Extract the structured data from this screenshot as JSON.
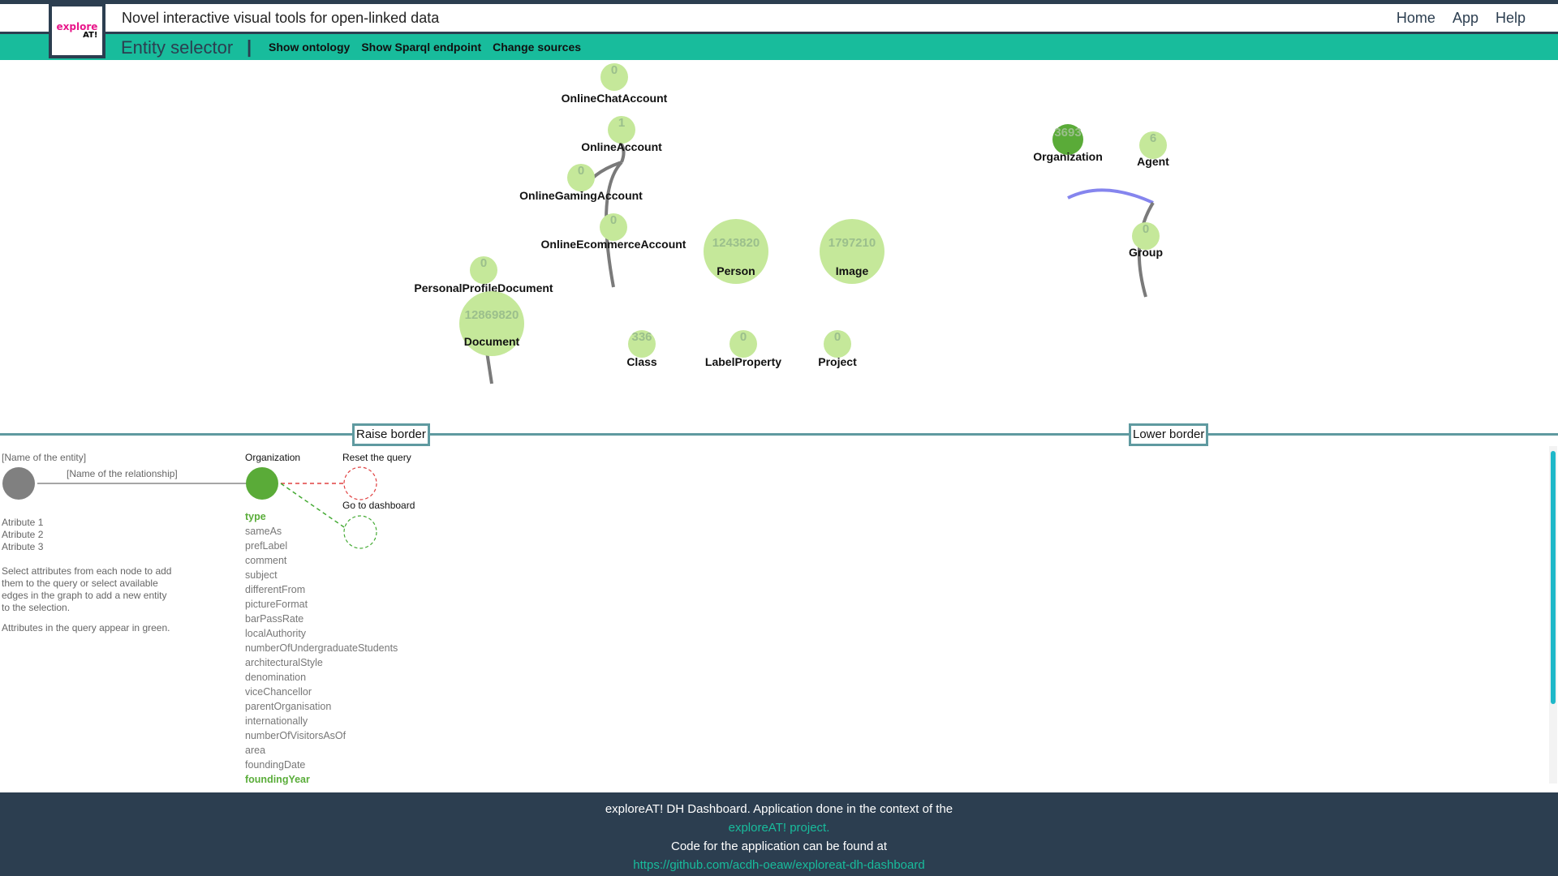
{
  "header": {
    "title": "Novel interactive visual tools for open-linked data",
    "nav": [
      "Home",
      "App",
      "Help"
    ],
    "logo_text_top": "explore",
    "logo_text_bottom": "AT!"
  },
  "subbar": {
    "page_name": "Entity selector",
    "separator": "|",
    "links": [
      "Show ontology",
      "Show Sparql endpoint",
      "Change sources"
    ]
  },
  "graph": {
    "nodes": [
      {
        "id": "OnlineChatAccount",
        "label": "OnlineChatAccount",
        "count": "0"
      },
      {
        "id": "OnlineAccount",
        "label": "OnlineAccount",
        "count": "1"
      },
      {
        "id": "OnlineGamingAccount",
        "label": "OnlineGamingAccount",
        "count": "0"
      },
      {
        "id": "OnlineEcommerceAccount",
        "label": "OnlineEcommerceAccount",
        "count": "0"
      },
      {
        "id": "PersonalProfileDocument",
        "label": "PersonalProfileDocument",
        "count": "0"
      },
      {
        "id": "Document",
        "label": "Document",
        "count": "12869820"
      },
      {
        "id": "Person",
        "label": "Person",
        "count": "1243820"
      },
      {
        "id": "Image",
        "label": "Image",
        "count": "1797210"
      },
      {
        "id": "Class",
        "label": "Class",
        "count": "336"
      },
      {
        "id": "LabelProperty",
        "label": "LabelProperty",
        "count": "0"
      },
      {
        "id": "Project",
        "label": "Project",
        "count": "0"
      },
      {
        "id": "Organization",
        "label": "Organization",
        "count": "3693",
        "selected": true
      },
      {
        "id": "Agent",
        "label": "Agent",
        "count": "6"
      },
      {
        "id": "Group",
        "label": "Group",
        "count": "0"
      }
    ],
    "colors": {
      "node": "#c5e89a",
      "selected_node": "#5aab38",
      "edge": "#7a7a7a",
      "query_edge": "#8585ee"
    }
  },
  "borders": {
    "raise": "Raise border",
    "lower": "Lower border"
  },
  "legend": {
    "entity_name": "[Name of the entity]",
    "relationship_name": "[Name of the relationship]",
    "attributes": [
      "Atribute 1",
      "Atribute 2",
      "Atribute 3"
    ],
    "help_text_lines": [
      "Select attributes from each node to add",
      "them to the query or select available",
      "edges in the graph to add a new entity",
      "to the selection."
    ],
    "help_text_2": "Attributes in the query appear in green."
  },
  "query": {
    "entity": "Organization",
    "reset_label": "Reset the query",
    "dashboard_label": "Go to dashboard",
    "attributes": [
      {
        "name": "type",
        "selected": true
      },
      {
        "name": "sameAs",
        "selected": false
      },
      {
        "name": "prefLabel",
        "selected": false
      },
      {
        "name": "comment",
        "selected": false
      },
      {
        "name": "subject",
        "selected": false
      },
      {
        "name": "differentFrom",
        "selected": false
      },
      {
        "name": "pictureFormat",
        "selected": false
      },
      {
        "name": "barPassRate",
        "selected": false
      },
      {
        "name": "localAuthority",
        "selected": false
      },
      {
        "name": "numberOfUndergraduateStudents",
        "selected": false
      },
      {
        "name": "architecturalStyle",
        "selected": false
      },
      {
        "name": "denomination",
        "selected": false
      },
      {
        "name": "viceChancellor",
        "selected": false
      },
      {
        "name": "parentOrganisation",
        "selected": false
      },
      {
        "name": "internationally",
        "selected": false
      },
      {
        "name": "numberOfVisitorsAsOf",
        "selected": false
      },
      {
        "name": "area",
        "selected": false
      },
      {
        "name": "foundingDate",
        "selected": false
      },
      {
        "name": "foundingYear",
        "selected": true
      }
    ]
  },
  "footer": {
    "line1": "exploreAT! DH Dashboard. Application done in the context of the",
    "link1": "exploreAT! project.",
    "line2": "Code for the application can be found at",
    "link2": "https://github.com/acdh-oeaw/exploreat-dh-dashboard"
  }
}
